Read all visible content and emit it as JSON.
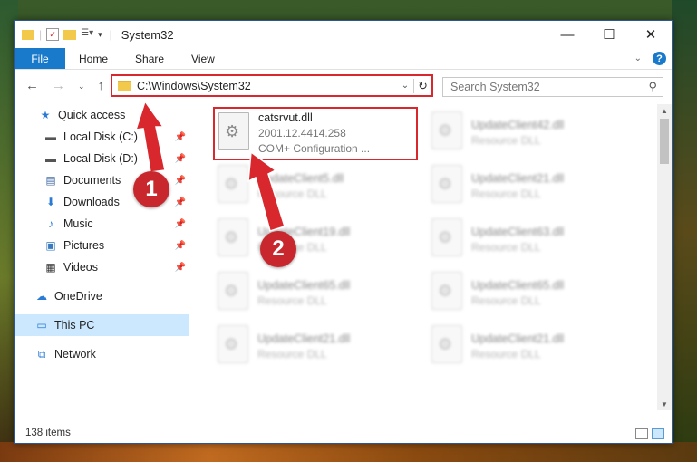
{
  "window": {
    "title": "System32"
  },
  "ribbon": {
    "file": "File",
    "home": "Home",
    "share": "Share",
    "view": "View"
  },
  "address": {
    "path": "C:\\Windows\\System32"
  },
  "search": {
    "placeholder": "Search System32"
  },
  "sidebar": {
    "items": [
      {
        "label": "Quick access",
        "icon": "star-icon",
        "pinned": false
      },
      {
        "label": "Local Disk (C:)",
        "icon": "disk-icon",
        "pinned": true
      },
      {
        "label": "Local Disk (D:)",
        "icon": "disk-icon",
        "pinned": true
      },
      {
        "label": "Documents",
        "icon": "document-icon",
        "pinned": true
      },
      {
        "label": "Downloads",
        "icon": "download-icon",
        "pinned": true
      },
      {
        "label": "Music",
        "icon": "music-icon",
        "pinned": true
      },
      {
        "label": "Pictures",
        "icon": "picture-icon",
        "pinned": true
      },
      {
        "label": "Videos",
        "icon": "video-icon",
        "pinned": true
      },
      {
        "label": "OneDrive",
        "icon": "cloud-icon",
        "pinned": false
      },
      {
        "label": "This PC",
        "icon": "computer-icon",
        "pinned": false
      },
      {
        "label": "Network",
        "icon": "network-icon",
        "pinned": false
      }
    ]
  },
  "files": [
    {
      "name": "catsrvut.dll",
      "line2": "2001.12.4414.258",
      "line3": "COM+ Configuration ..."
    },
    {
      "name": "UpdateClient42.dll",
      "line2": "Resource DLL"
    },
    {
      "name": "UpdateClient5.dll",
      "line2": "Resource DLL"
    },
    {
      "name": "UpdateClient21.dll",
      "line2": "Resource DLL"
    },
    {
      "name": "UpdateClient19.dll",
      "line2": "Resource DLL"
    },
    {
      "name": "UpdateClient63.dll",
      "line2": "Resource DLL"
    },
    {
      "name": "UpdateClient65.dll",
      "line2": "Resource DLL"
    },
    {
      "name": "UpdateClient65.dll",
      "line2": "Resource DLL"
    },
    {
      "name": "UpdateClient21.dll",
      "line2": "Resource DLL"
    },
    {
      "name": "UpdateClient21.dll",
      "line2": "Resource DLL"
    }
  ],
  "status": {
    "items": "138 items"
  },
  "annotations": {
    "step1": "1",
    "step2": "2"
  },
  "colors": {
    "accent": "#1979ca",
    "highlight": "#d9282d",
    "selected": "#cce8ff"
  }
}
